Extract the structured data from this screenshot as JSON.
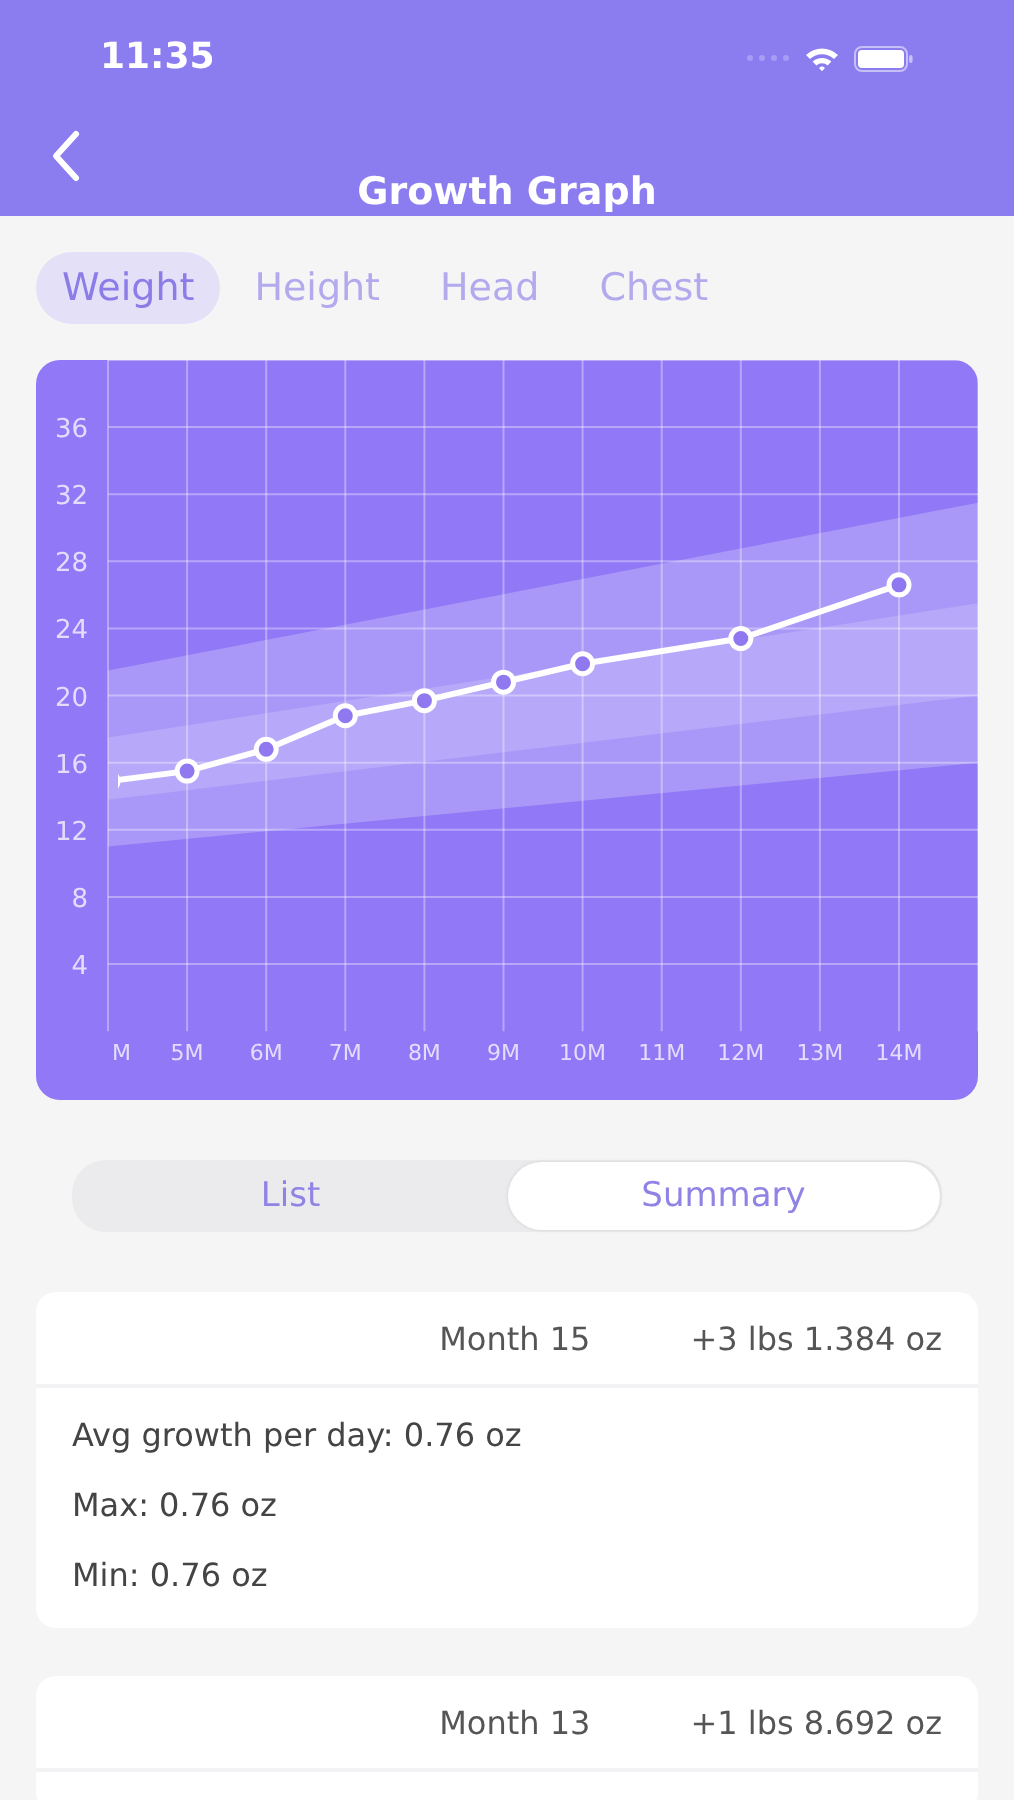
{
  "status_bar": {
    "time": "11:35"
  },
  "nav": {
    "title": "Growth Graph"
  },
  "tabs": [
    {
      "label": "Weight",
      "selected": true
    },
    {
      "label": "Height",
      "selected": false
    },
    {
      "label": "Head",
      "selected": false
    },
    {
      "label": "Chest",
      "selected": false
    }
  ],
  "chart": {
    "chart_data": {
      "type": "line",
      "grid": true,
      "categories": [
        "M",
        "5M",
        "6M",
        "7M",
        "8M",
        "9M",
        "10M",
        "11M",
        "12M",
        "13M",
        "14M"
      ],
      "ylim": [
        0,
        40
      ],
      "yticks": [
        4,
        8,
        12,
        16,
        20,
        24,
        28,
        32,
        36
      ],
      "series": [
        {
          "color": "#ffffff",
          "marker": true,
          "values": [
            14.9,
            15.5,
            16.8,
            18.8,
            19.7,
            20.8,
            21.9,
            null,
            23.4,
            null,
            26.6
          ]
        }
      ]
    }
  },
  "view_toggle": [
    {
      "label": "List",
      "selected": false
    },
    {
      "label": "Summary",
      "selected": true
    }
  ],
  "summaries": [
    {
      "month": "Month 15",
      "change": "+3 lbs 1.384 oz",
      "lines": [
        "Avg growth per day: 0.76 oz",
        "Max: 0.76 oz",
        "Min: 0.76 oz"
      ]
    },
    {
      "month": "Month 13",
      "change": "+1 lbs 8.692 oz"
    }
  ]
}
